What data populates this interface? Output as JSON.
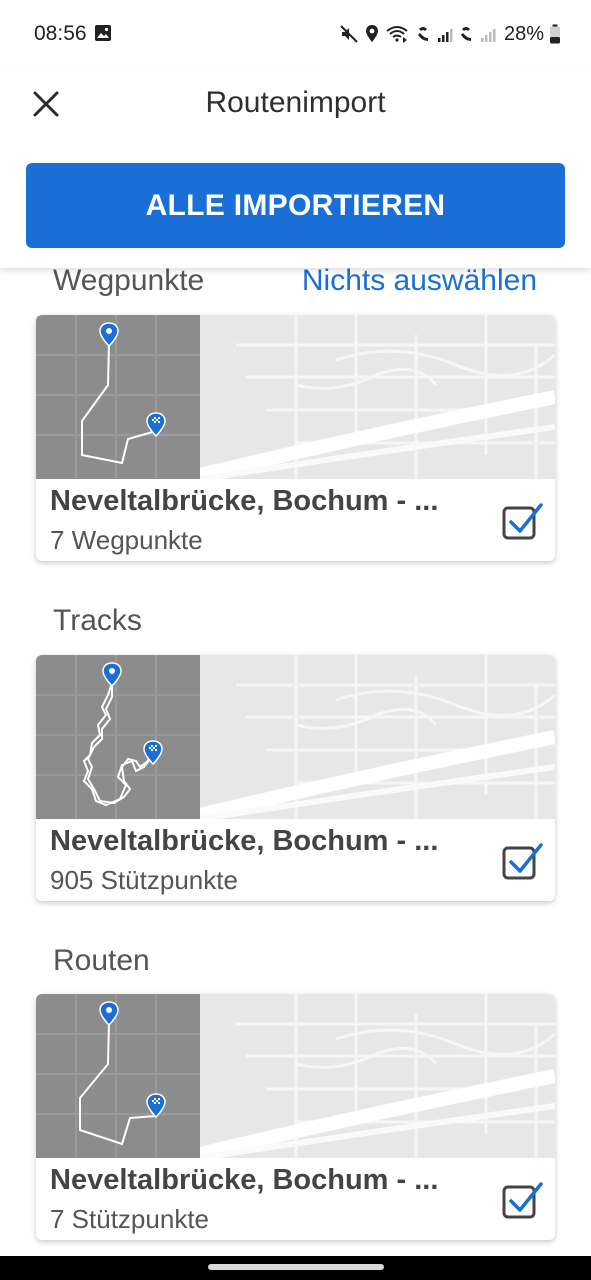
{
  "status_bar": {
    "time": "08:56",
    "battery": "28%"
  },
  "header": {
    "title": "Routenimport",
    "import_all_label": "ALLE IMPORTIEREN"
  },
  "sections": [
    {
      "heading": "Wegpunkte",
      "action_label": "Nichts auswählen",
      "card": {
        "title": "Neveltalbrücke, Bochum - ...",
        "subtitle": "7 Wegpunkte",
        "checked": true
      }
    },
    {
      "heading": "Tracks",
      "card": {
        "title": "Neveltalbrücke, Bochum - ...",
        "subtitle": "905 Stützpunkte",
        "checked": true
      }
    },
    {
      "heading": "Routen",
      "card": {
        "title": "Neveltalbrücke, Bochum - ...",
        "subtitle": "7 Stützpunkte",
        "checked": true
      }
    }
  ],
  "colors": {
    "accent": "#1a6fd6",
    "map_background": "#e7e7e7",
    "thumbnail_background": "#8c8c8c"
  },
  "icons": {
    "close": "close-icon",
    "checkbox": "checkbox-checked-icon",
    "start_pin": "map-pin-icon",
    "finish_pin": "finish-flag-pin-icon"
  }
}
